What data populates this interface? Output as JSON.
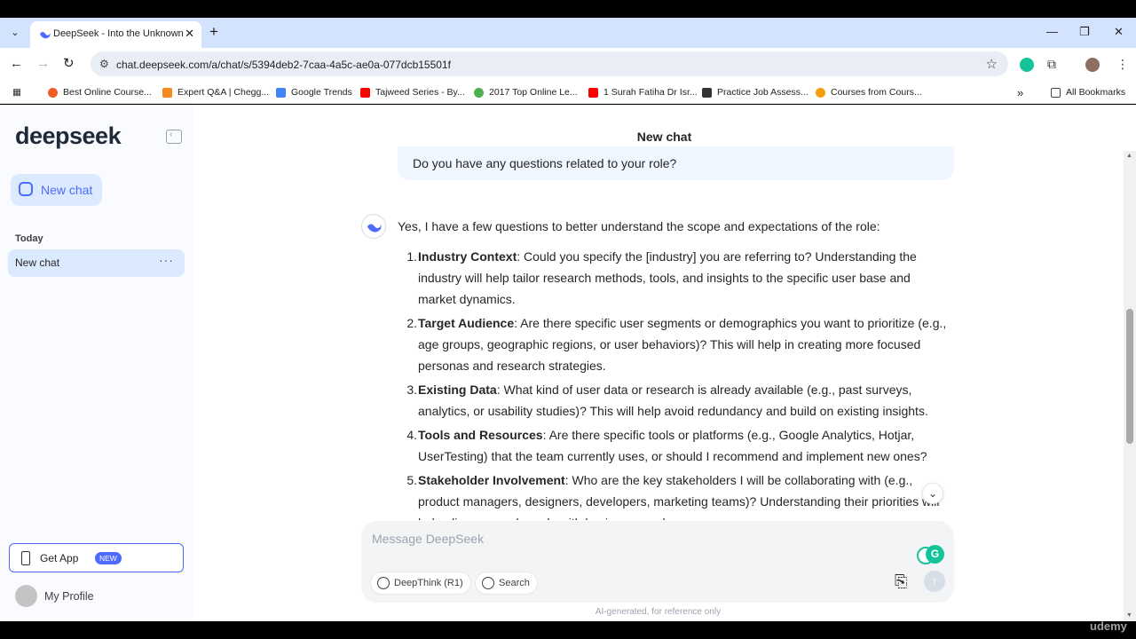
{
  "browser": {
    "tab_title": "DeepSeek - Into the Unknown",
    "url": "chat.deepseek.com/a/chat/s/5394deb2-7caa-4a5c-ae0a-077dcb15501f",
    "bookmarks": [
      {
        "label": "Best Online Course...",
        "color": "#ef5b25"
      },
      {
        "label": "Expert Q&A | Chegg...",
        "color": "#f6891f"
      },
      {
        "label": "Google Trends",
        "color": "#4285f4"
      },
      {
        "label": "Tajweed Series - By...",
        "color": "#ff0000"
      },
      {
        "label": "2017 Top Online Le...",
        "color": "#4caf50"
      },
      {
        "label": "1 Surah Fatiha Dr Isr...",
        "color": "#ff0000"
      },
      {
        "label": "Practice Job Assess...",
        "color": "#333333"
      },
      {
        "label": "Courses from Cours...",
        "color": "#f59e0b"
      }
    ],
    "all_bookmarks": "All Bookmarks"
  },
  "sidebar": {
    "logo": "deepseek",
    "new_chat": "New chat",
    "section": "Today",
    "chat_item": "New chat",
    "get_app": "Get App",
    "badge": "NEW",
    "profile": "My Profile"
  },
  "main": {
    "title": "New chat",
    "user_message": "Do you have any questions related to your role?",
    "intro": "Yes, I have a few questions to better understand the scope and expectations of the role:",
    "items": [
      {
        "num": "1.",
        "bold": "Industry Context",
        "text": ": Could you specify the [industry] you are referring to? Understanding the industry will help tailor research methods, tools, and insights to the specific user base and market dynamics."
      },
      {
        "num": "2.",
        "bold": "Target Audience",
        "text": ": Are there specific user segments or demographics you want to prioritize (e.g., age groups, geographic regions, or user behaviors)? This will help in creating more focused personas and research strategies."
      },
      {
        "num": "3.",
        "bold": "Existing Data",
        "text": ": What kind of user data or research is already available (e.g., past surveys, analytics, or usability studies)? This will help avoid redundancy and build on existing insights."
      },
      {
        "num": "4.",
        "bold": "Tools and Resources",
        "text": ": Are there specific tools or platforms (e.g., Google Analytics, Hotjar, UserTesting) that the team currently uses, or should I recommend and implement new ones?"
      },
      {
        "num": "5.",
        "bold": "Stakeholder Involvement",
        "text": ": Who are the key stakeholders I will be collaborating with (e.g., product managers, designers, developers, marketing teams)? Understanding their priorities will help align research goals with business needs."
      }
    ],
    "placeholder": "Message DeepSeek",
    "deepthink": "DeepThink (R1)",
    "search": "Search",
    "disclaimer": "AI-generated, for reference only"
  },
  "overlay": {
    "watermark": "udemy"
  }
}
